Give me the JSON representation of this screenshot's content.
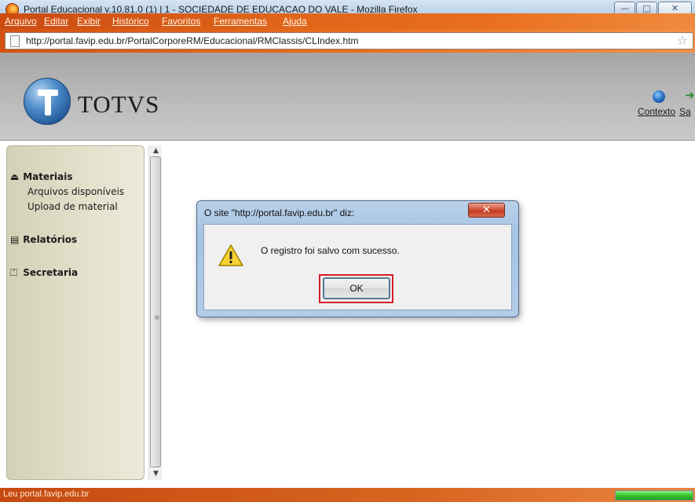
{
  "window": {
    "title": "Portal Educacional v.10.81.0 (1) | 1 - SOCIEDADE DE EDUCACAO DO VALE - Mozilla Firefox",
    "min_glyph": "—",
    "max_glyph": "□",
    "close_glyph": "✕"
  },
  "menubar": {
    "items": [
      "Arquivo",
      "Editar",
      "Exibir",
      "Histórico",
      "Favoritos",
      "Ferramentas",
      "Ajuda"
    ]
  },
  "address": {
    "url": "http://portal.favip.edu.br/PortalCorporeRM/Educacional/RMClassis/CLIndex.htm",
    "star_glyph": "☆"
  },
  "portal_header": {
    "brand": "TOTVS",
    "links": {
      "contexto": "Contexto",
      "sair": "Sa"
    }
  },
  "sidebar": {
    "materiais": {
      "label": "Materiais",
      "icon_glyph": "⏏",
      "items": [
        "Arquivos disponíveis",
        "Upload de material"
      ]
    },
    "relatorios": {
      "label": "Relatórios",
      "icon_glyph": "▤"
    },
    "secretaria": {
      "label": "Secretaria",
      "icon_glyph": "⏍"
    },
    "scroll_up": "▲",
    "scroll_down": "▼"
  },
  "dialog": {
    "title": "O site \"http://portal.favip.edu.br\" diz:",
    "message": "O registro foi salvo com sucesso.",
    "ok_label": "OK",
    "close_glyph": "✕"
  },
  "status": {
    "text": "Leu portal.favip.edu.br",
    "progress": 1.0
  },
  "colors": {
    "persona_orange": "#e0641a",
    "header_gray": "#b6b6b6",
    "sidebar_bg": "#e3e2cd",
    "highlight_red": "#d2202a"
  }
}
